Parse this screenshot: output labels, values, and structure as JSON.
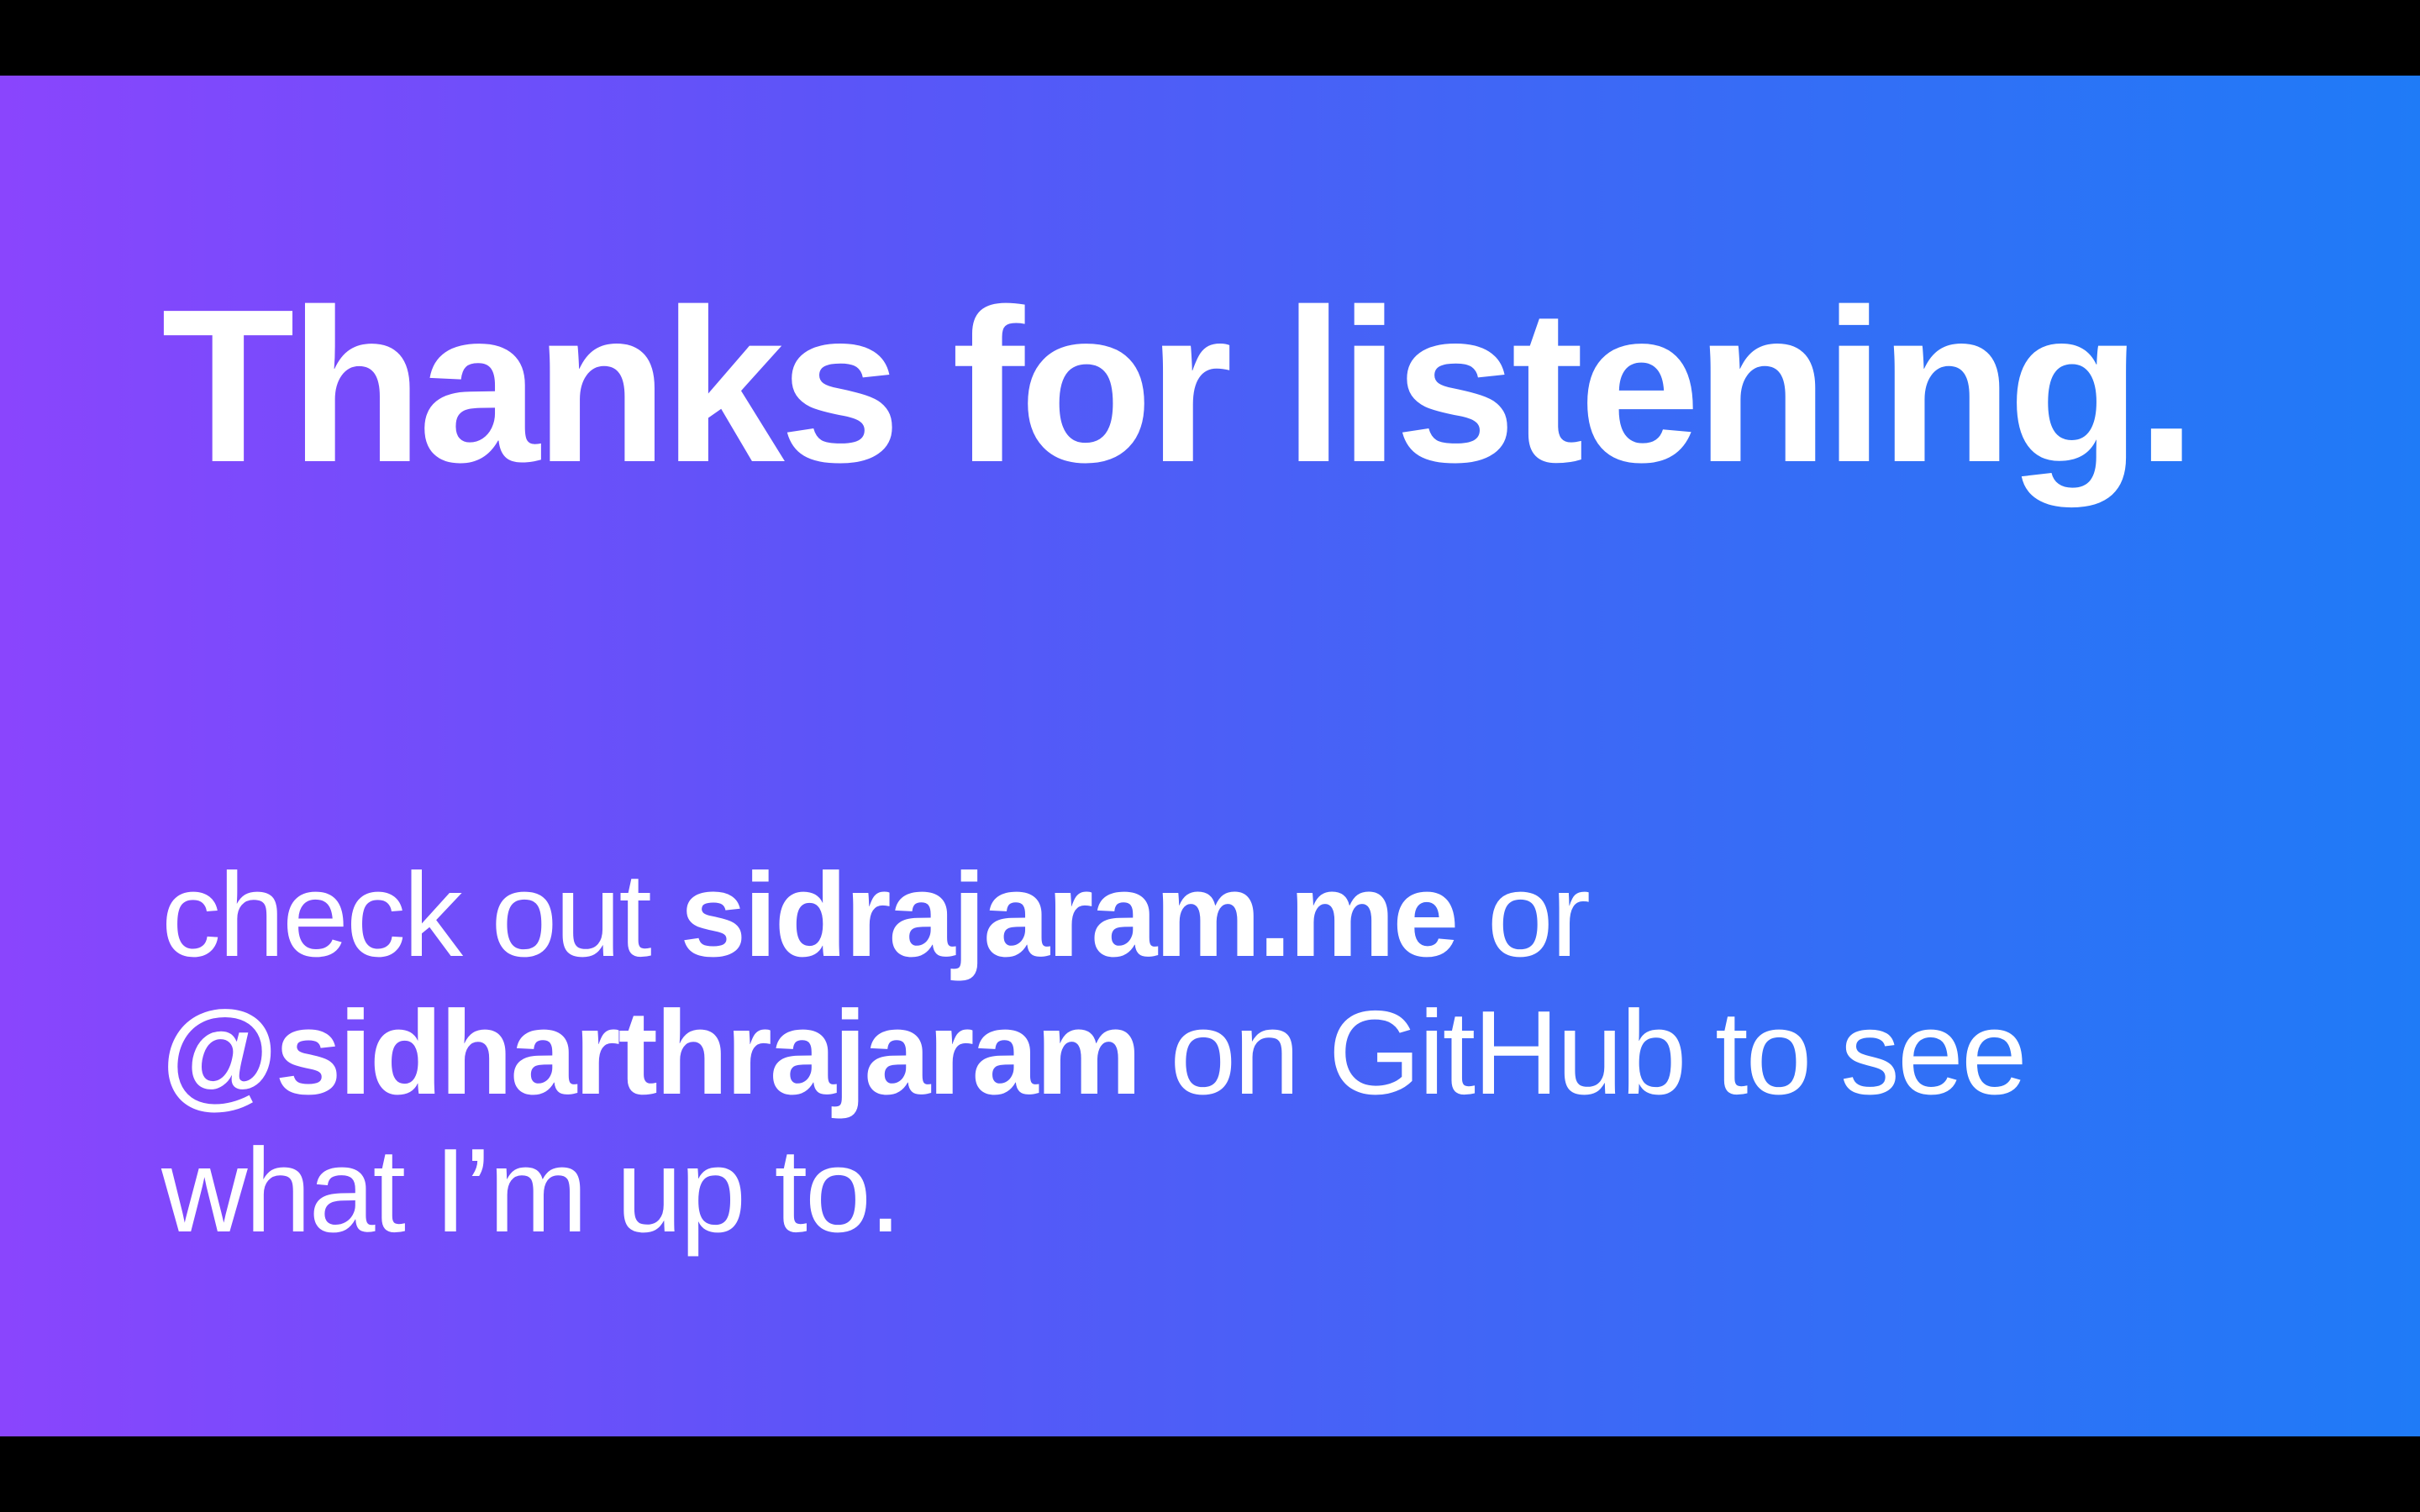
{
  "slide": {
    "title": "Thanks for listening.",
    "body": {
      "line1_prefix": "check out ",
      "website": "sidrajaram.me",
      "line1_suffix": " or",
      "github_handle": "@sidharthrajaram",
      "line2_suffix": " on GitHub to see",
      "line3": "what I’m up to."
    }
  },
  "colors": {
    "gradient_start": "#8a45fd",
    "gradient_end": "#1f7bf7",
    "letterbox": "#000000",
    "text": "#ffffff"
  }
}
